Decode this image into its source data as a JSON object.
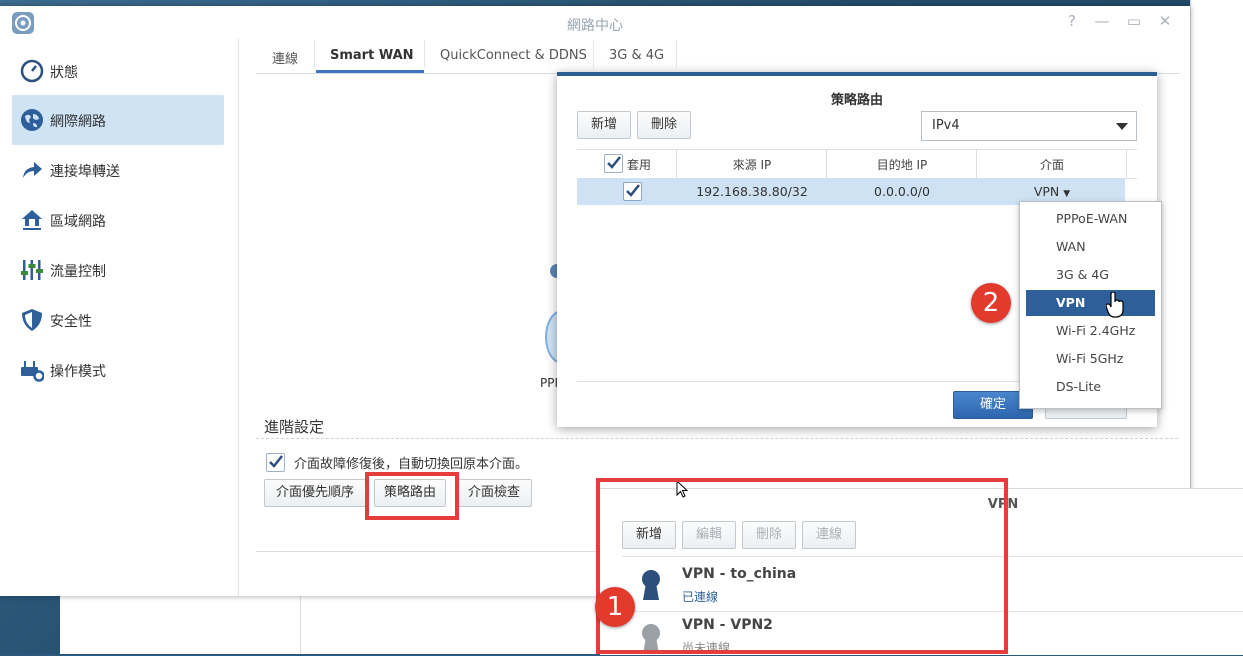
{
  "window": {
    "title": "網路中心"
  },
  "sidebar": {
    "items": [
      {
        "label": "狀態",
        "icon": "gauge-icon"
      },
      {
        "label": "網際網路",
        "icon": "globe-icon",
        "active": true
      },
      {
        "label": "連接埠轉送",
        "icon": "forward-arrow-icon"
      },
      {
        "label": "區域網路",
        "icon": "home-network-icon"
      },
      {
        "label": "流量控制",
        "icon": "sliders-icon"
      },
      {
        "label": "安全性",
        "icon": "shield-icon"
      },
      {
        "label": "操作模式",
        "icon": "router-gear-icon"
      }
    ]
  },
  "tabs": [
    {
      "label": "連線"
    },
    {
      "label": "Smart WAN",
      "active": true
    },
    {
      "label": "QuickConnect & DDNS"
    },
    {
      "label": "3G & 4G"
    }
  ],
  "background": {
    "partial_label": "PPP"
  },
  "advanced": {
    "title": "進階設定",
    "failback_label": "介面故障修復後，自動切換回原本介面。",
    "failback_checked": true,
    "buttons": {
      "priority": "介面優先順序",
      "policy_route": "策略路由",
      "check": "介面檢查"
    }
  },
  "policy_dialog": {
    "title": "策略路由",
    "add": "新增",
    "delete": "刪除",
    "ip_version": "IPv4",
    "columns": {
      "apply": "套用",
      "source_ip": "來源 IP",
      "dest_ip": "目的地 IP",
      "interface": "介面"
    },
    "rows": [
      {
        "apply": true,
        "source_ip": "192.168.38.80/32",
        "dest_ip": "0.0.0.0/0",
        "interface": "VPN"
      }
    ],
    "ok": "確定"
  },
  "interface_menu": {
    "options": [
      "PPPoE-WAN",
      "WAN",
      "3G & 4G",
      "VPN",
      "Wi-Fi 2.4GHz",
      "Wi-Fi 5GHz",
      "DS-Lite"
    ],
    "selected": "VPN"
  },
  "vpn_panel": {
    "title": "VPN",
    "toolbar": {
      "add": "新增",
      "edit": "編輯",
      "delete": "刪除",
      "connect": "連線"
    },
    "items": [
      {
        "name": "VPN - to_china",
        "status": "已連線",
        "status_color": "#2d5f9a",
        "icon_color": "#2d4f7c"
      },
      {
        "name": "VPN - VPN2",
        "status": "尚未連線",
        "status_color": "#888888",
        "icon_color": "#9aa0a6"
      }
    ]
  },
  "badges": {
    "one": "1",
    "two": "2"
  },
  "colors": {
    "accent": "#2f5f99",
    "highlight_row": "#cfe2f3",
    "annotation_red": "#e53c3c"
  }
}
